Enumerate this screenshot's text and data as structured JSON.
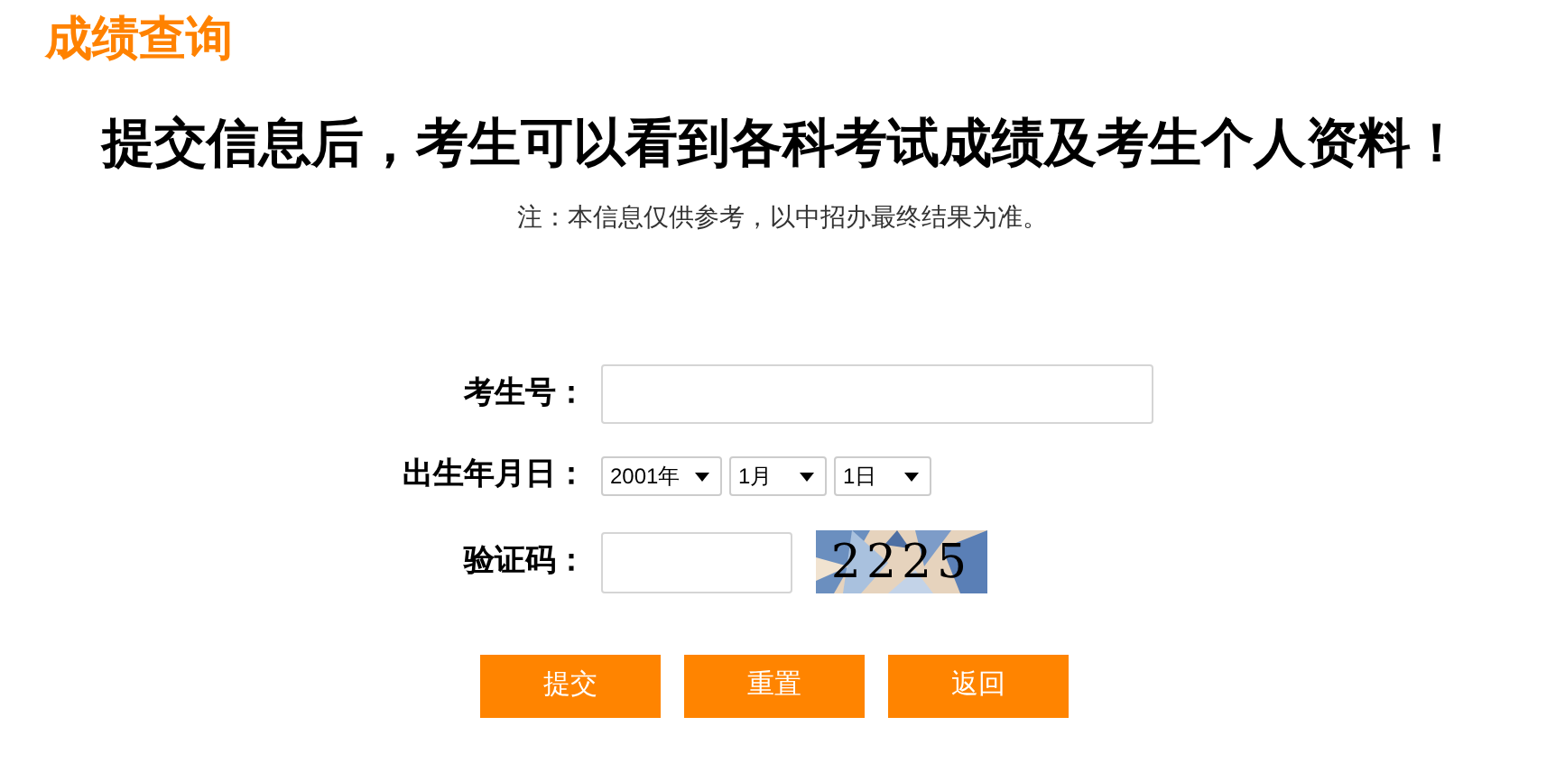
{
  "page_title": "成绩查询",
  "heading": "提交信息后，考生可以看到各科考试成绩及考生个人资料！",
  "note": "注：本信息仅供参考，以中招办最终结果为准。",
  "form": {
    "fields": [
      {
        "kind": "text",
        "label": "考生号："
      },
      {
        "kind": "date",
        "label": "出生年月日：",
        "selects": [
          "2001年",
          "1月",
          "1日"
        ]
      },
      {
        "kind": "captcha",
        "label": "验证码：",
        "captcha": "2225"
      }
    ]
  },
  "buttons": [
    "提交",
    "重置",
    "返回"
  ]
}
